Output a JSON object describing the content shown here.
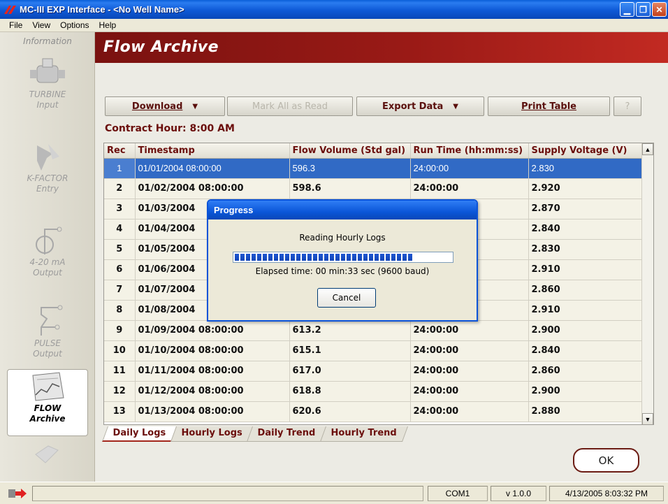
{
  "window": {
    "title": "MC-III EXP Interface - <No Well Name>",
    "buttons": [
      "minimize",
      "maximize",
      "close"
    ]
  },
  "menu": [
    "File",
    "View",
    "Options",
    "Help"
  ],
  "sidebar": {
    "header": "Information",
    "items": [
      {
        "line1": "TURBINE",
        "line2": "Input",
        "icon": "turbine-icon",
        "active": false
      },
      {
        "line1": "K-FACTOR",
        "line2": "Entry",
        "icon": "kfactor-icon",
        "active": false
      },
      {
        "line1": "4-20 mA",
        "line2": "Output",
        "icon": "analog-output-icon",
        "active": false
      },
      {
        "line1": "PULSE",
        "line2": "Output",
        "icon": "pulse-output-icon",
        "active": false
      },
      {
        "line1": "FLOW",
        "line2": "Archive",
        "icon": "flow-archive-icon",
        "active": true
      }
    ]
  },
  "page_title": "Flow Archive",
  "toolbar": {
    "download": "Download",
    "mark_all": "Mark All as Read",
    "export": "Export Data",
    "print": "Print Table",
    "help": "?"
  },
  "contract_hour": "Contract Hour: 8:00 AM",
  "table": {
    "columns": [
      "Rec",
      "Timestamp",
      "Flow Volume (Std gal)",
      "Run Time (hh:mm:ss)",
      "Supply Voltage (V)"
    ],
    "rows": [
      [
        "1",
        "01/01/2004 08:00:00",
        "596.3",
        "24:00:00",
        "2.830"
      ],
      [
        "2",
        "01/02/2004 08:00:00",
        "598.6",
        "24:00:00",
        "2.920"
      ],
      [
        "3",
        "01/03/2004",
        "",
        "",
        "2.870"
      ],
      [
        "4",
        "01/04/2004",
        "",
        "",
        "2.840"
      ],
      [
        "5",
        "01/05/2004",
        "",
        "",
        "2.830"
      ],
      [
        "6",
        "01/06/2004",
        "",
        "",
        "2.910"
      ],
      [
        "7",
        "01/07/2004",
        "",
        "",
        "2.860"
      ],
      [
        "8",
        "01/08/2004",
        "",
        "",
        "2.910"
      ],
      [
        "9",
        "01/09/2004 08:00:00",
        "613.2",
        "24:00:00",
        "2.900"
      ],
      [
        "10",
        "01/10/2004 08:00:00",
        "615.1",
        "24:00:00",
        "2.840"
      ],
      [
        "11",
        "01/11/2004 08:00:00",
        "617.0",
        "24:00:00",
        "2.860"
      ],
      [
        "12",
        "01/12/2004 08:00:00",
        "618.8",
        "24:00:00",
        "2.900"
      ],
      [
        "13",
        "01/13/2004 08:00:00",
        "620.6",
        "24:00:00",
        "2.880"
      ]
    ],
    "selected_row": 0
  },
  "tabs": [
    "Daily Logs",
    "Hourly Logs",
    "Daily Trend",
    "Hourly Trend"
  ],
  "active_tab": 0,
  "ok_label": "OK",
  "status": {
    "port": "COM1",
    "version": "v 1.0.0",
    "datetime": "4/13/2005 8:03:32 PM"
  },
  "progress_dialog": {
    "title": "Progress",
    "message": "Reading Hourly Logs",
    "progress_fraction": 0.83,
    "elapsed": "Elapsed time: 00 min:33 sec (9600 baud)",
    "cancel": "Cancel"
  },
  "colors": {
    "accent": "#6b0e0c",
    "banner": "#9a1a16",
    "selection": "#316ac5",
    "xp_blue": "#0b56d8"
  }
}
